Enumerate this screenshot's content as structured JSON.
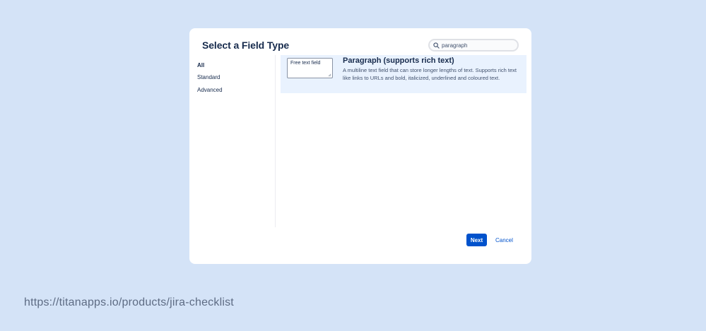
{
  "dialog": {
    "title": "Select a Field Type",
    "search": {
      "value": "paragraph",
      "placeholder": "paragraph"
    },
    "sidebar": {
      "items": [
        {
          "label": "All",
          "active": true
        },
        {
          "label": "Standard",
          "active": false
        },
        {
          "label": "Advanced",
          "active": false
        }
      ]
    },
    "results": [
      {
        "preview_text": "Free text field",
        "title": "Paragraph (supports rich text)",
        "description": "A multiline text field that can store longer lengths of text. Supports rich text like links to URLs and bold, italicized, underlined and coloured text."
      }
    ],
    "buttons": {
      "next_label": "Next",
      "cancel_label": "Cancel"
    }
  },
  "footer": {
    "url_text": "https://titanapps.io/products/jira-checklist"
  },
  "colors": {
    "background": "#d4e3f7",
    "dialog": "#ffffff",
    "primary": "#0052cc",
    "selected_row": "#e9f2fe",
    "text_dark": "#172b4d",
    "footer_text": "#5e6c84"
  }
}
